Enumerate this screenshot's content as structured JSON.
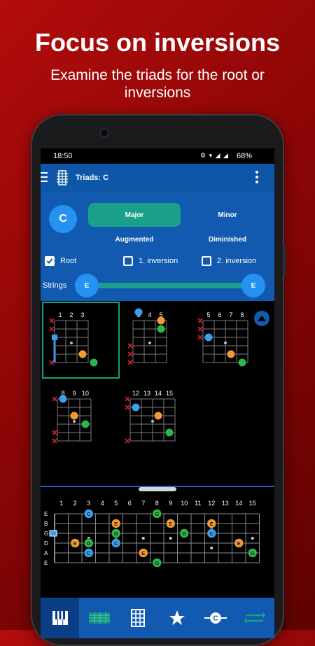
{
  "promo": {
    "headline": "Focus on inversions",
    "subheadline": "Examine the triads for the root or inversions"
  },
  "status": {
    "time": "18:50",
    "icons": "⚙ ▾ ◢ ◢",
    "battery": "68%"
  },
  "appbar": {
    "title": "Triads: C"
  },
  "panel": {
    "key": "C",
    "quality": {
      "major": "Major",
      "minor": "Minor",
      "augmented": "Augmented",
      "diminished": "Diminished",
      "selected": "Major"
    },
    "checks": {
      "root": "Root",
      "inv1": "1. inversion",
      "inv2": "2. inversion",
      "root_checked": true,
      "inv1_checked": false,
      "inv2_checked": false
    },
    "strings_label": "Strings",
    "strings_low": "E",
    "strings_high": "E"
  },
  "colors": {
    "root_note": "#3aa0ee",
    "third_note": "#f39a33",
    "fifth_note": "#2fb64a",
    "muted_x": "#d21f2b",
    "accent": "#1aa08a",
    "app_blue": "#1259b0"
  },
  "diagrams": [
    {
      "frets": [
        "1",
        "2",
        "3"
      ],
      "selected": true
    },
    {
      "frets": [
        "3",
        "4",
        "5"
      ],
      "selected": false
    },
    {
      "frets": [
        "5",
        "6",
        "7",
        "8"
      ],
      "selected": false
    },
    {
      "frets": [
        "8",
        "9",
        "10"
      ],
      "selected": false
    },
    {
      "frets": [
        "12",
        "13",
        "14",
        "15"
      ],
      "selected": false
    }
  ],
  "fretboard": {
    "fret_numbers": [
      "1",
      "2",
      "3",
      "4",
      "5",
      "6",
      "7",
      "8",
      "9",
      "10",
      "11",
      "12",
      "13",
      "14",
      "15"
    ],
    "string_names": [
      "E",
      "B",
      "G",
      "D",
      "A",
      "E"
    ],
    "notes": [
      {
        "fret": 3,
        "string": 1,
        "label": "C",
        "role": "root"
      },
      {
        "fret": 5,
        "string": 2,
        "label": "E",
        "role": "third"
      },
      {
        "fret": 5,
        "string": 3,
        "label": "G",
        "role": "fifth"
      },
      {
        "fret": 5,
        "string": 4,
        "label": "C",
        "role": "root"
      },
      {
        "fret": 8,
        "string": 1,
        "label": "G",
        "role": "fifth"
      },
      {
        "fret": 9,
        "string": 2,
        "label": "E",
        "role": "third"
      },
      {
        "fret": 10,
        "string": 3,
        "label": "G",
        "role": "fifth"
      },
      {
        "fret": 12,
        "string": 2,
        "label": "E",
        "role": "third"
      },
      {
        "fret": 12,
        "string": 3,
        "label": "C",
        "role": "root"
      },
      {
        "fret": 14,
        "string": 4,
        "label": "E",
        "role": "third"
      },
      {
        "fret": 15,
        "string": 5,
        "label": "G",
        "role": "fifth"
      },
      {
        "fret": 2,
        "string": 4,
        "label": "E",
        "role": "third"
      },
      {
        "fret": 3,
        "string": 4,
        "label": "G",
        "role": "fifth"
      },
      {
        "fret": 3,
        "string": 5,
        "label": "C",
        "role": "root"
      },
      {
        "fret": 7,
        "string": 5,
        "label": "E",
        "role": "third"
      },
      {
        "fret": 8,
        "string": 6,
        "label": "G",
        "role": "fifth"
      }
    ]
  },
  "bottomnav": [
    {
      "name": "piano-icon",
      "active": true
    },
    {
      "name": "fretboard-icon",
      "active": false
    },
    {
      "name": "grid-icon",
      "active": false
    },
    {
      "name": "star-icon",
      "active": false
    },
    {
      "name": "chord-icon",
      "active": false
    },
    {
      "name": "swap-icon",
      "active": false
    }
  ]
}
